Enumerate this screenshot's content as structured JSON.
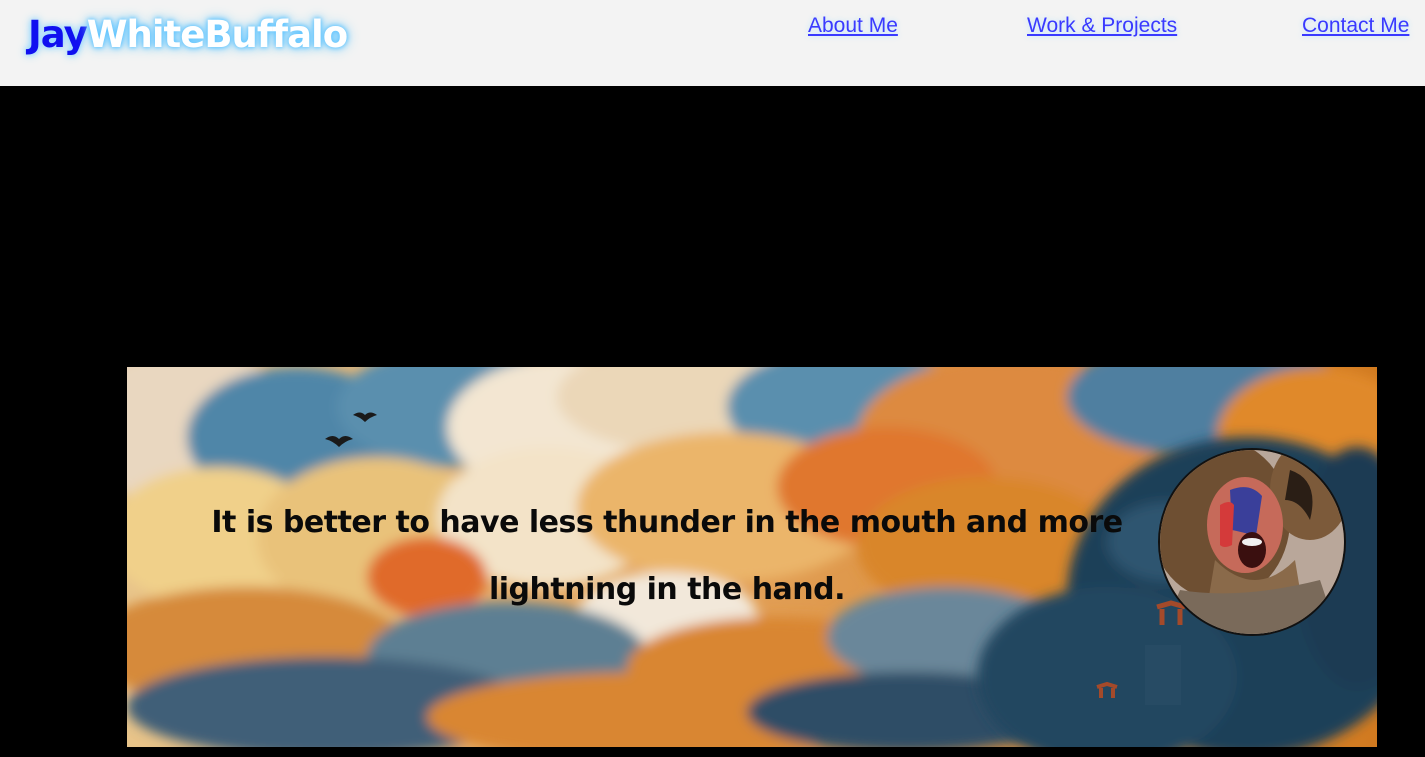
{
  "header": {
    "logo_first": "Jay",
    "logo_rest": "WhiteBuffalo",
    "nav": [
      {
        "label": "About Me"
      },
      {
        "label": "Work & Projects"
      },
      {
        "label": "Contact Me"
      }
    ]
  },
  "hero": {
    "quote": "It is better to have less thunder in the mouth and more lightning in the hand."
  },
  "colors": {
    "header_bg": "#f3f3f3",
    "page_bg": "#000000",
    "logo_accent": "#1010f0",
    "link": "#3a3aff"
  }
}
